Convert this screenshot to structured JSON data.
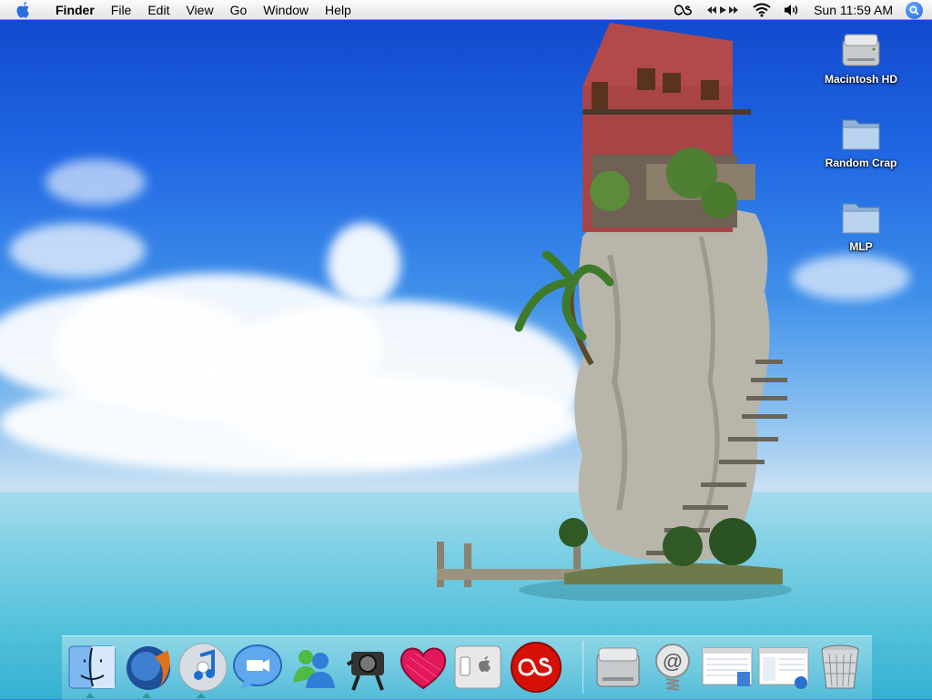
{
  "menubar": {
    "app_name": "Finder",
    "menus": [
      "File",
      "Edit",
      "View",
      "Go",
      "Window",
      "Help"
    ],
    "status_icons": [
      "lastfm-menu-icon",
      "media-controls-icon",
      "wifi-icon",
      "volume-icon"
    ],
    "clock": "Sun 11:59 AM"
  },
  "desktop": {
    "icons": [
      {
        "label": "Macintosh HD",
        "icon": "hard-drive-icon"
      },
      {
        "label": "Random Crap",
        "icon": "folder-icon"
      },
      {
        "label": "MLP",
        "icon": "folder-icon"
      }
    ]
  },
  "dock": {
    "items": [
      {
        "name": "finder",
        "icon": "finder-icon",
        "running": true
      },
      {
        "name": "firefox",
        "icon": "firefox-icon",
        "running": true
      },
      {
        "name": "itunes",
        "icon": "itunes-icon",
        "running": true
      },
      {
        "name": "ichat",
        "icon": "ichat-icon",
        "running": false
      },
      {
        "name": "messenger",
        "icon": "messenger-icon",
        "running": false
      },
      {
        "name": "camera-thief",
        "icon": "camera-thief-icon",
        "running": false
      },
      {
        "name": "heart-app",
        "icon": "heart-icon",
        "running": false
      },
      {
        "name": "system-prefs",
        "icon": "apple-switch-icon",
        "running": false
      },
      {
        "name": "lastfm",
        "icon": "lastfm-icon",
        "running": false
      },
      {
        "name": "macintosh-hd",
        "icon": "hard-drive-icon",
        "running": false
      },
      {
        "name": "mail",
        "icon": "mail-spring-icon",
        "running": false
      },
      {
        "name": "window-1",
        "icon": "window-thumb-icon",
        "running": false
      },
      {
        "name": "window-2",
        "icon": "window-thumb-icon",
        "running": false
      },
      {
        "name": "trash",
        "icon": "trash-icon",
        "running": false
      }
    ]
  },
  "colors": {
    "sky_top": "#0f46c9",
    "sea": "#4fbfd9",
    "spotlight": "#1a5fd6",
    "lastfm": "#d51007"
  }
}
